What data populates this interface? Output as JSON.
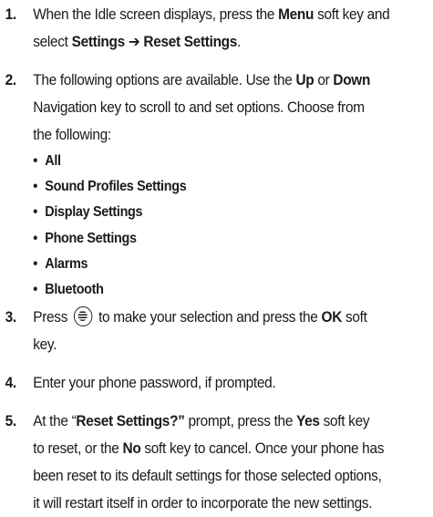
{
  "steps": [
    {
      "num": "1.",
      "lines": [
        [
          {
            "t": "When the Idle screen displays, press the ",
            "b": false
          },
          {
            "t": "Menu",
            "b": true
          },
          {
            "t": " soft key and",
            "b": false
          }
        ],
        [
          {
            "t": "select ",
            "b": false
          },
          {
            "t": "Settings ➔ Reset Settings",
            "b": true
          },
          {
            "t": ".",
            "b": false
          }
        ]
      ]
    },
    {
      "num": "2.",
      "lines": [
        [
          {
            "t": "The following options are available. Use the ",
            "b": false
          },
          {
            "t": "Up",
            "b": true
          },
          {
            "t": " or ",
            "b": false
          },
          {
            "t": "Down",
            "b": true
          }
        ],
        [
          {
            "t": "Navigation key to scroll to and set options. Choose from",
            "b": false
          }
        ],
        [
          {
            "t": "the following:",
            "b": false
          }
        ]
      ],
      "options": [
        "All",
        "Sound Profiles Settings",
        "Display Settings",
        "Phone Settings",
        "Alarms",
        "Bluetooth"
      ]
    },
    {
      "num": "3.",
      "lines": [
        [
          {
            "t": "Press ",
            "b": false
          },
          {
            "icon": "navigation-key-icon"
          },
          {
            "t": " to make your selection and press the ",
            "b": false
          },
          {
            "t": "OK",
            "b": true
          },
          {
            "t": " soft",
            "b": false
          }
        ],
        [
          {
            "t": "key.",
            "b": false
          }
        ]
      ]
    },
    {
      "num": "4.",
      "lines": [
        [
          {
            "t": "Enter your phone password, if prompted.",
            "b": false
          }
        ]
      ]
    },
    {
      "num": "5.",
      "lines": [
        [
          {
            "t": "At the “",
            "b": false
          },
          {
            "t": "Reset Settings?”",
            "b": true
          },
          {
            "t": " prompt, press the ",
            "b": false
          },
          {
            "t": "Yes",
            "b": true
          },
          {
            "t": " soft key",
            "b": false
          }
        ],
        [
          {
            "t": "to reset, or the ",
            "b": false
          },
          {
            "t": "No",
            "b": true
          },
          {
            "t": " soft key to cancel. Once your phone has",
            "b": false
          }
        ],
        [
          {
            "t": "been reset to its default settings for those selected options,",
            "b": false
          }
        ],
        [
          {
            "t": "it will restart itself in order to incorporate the new settings.",
            "b": false
          }
        ]
      ]
    }
  ]
}
